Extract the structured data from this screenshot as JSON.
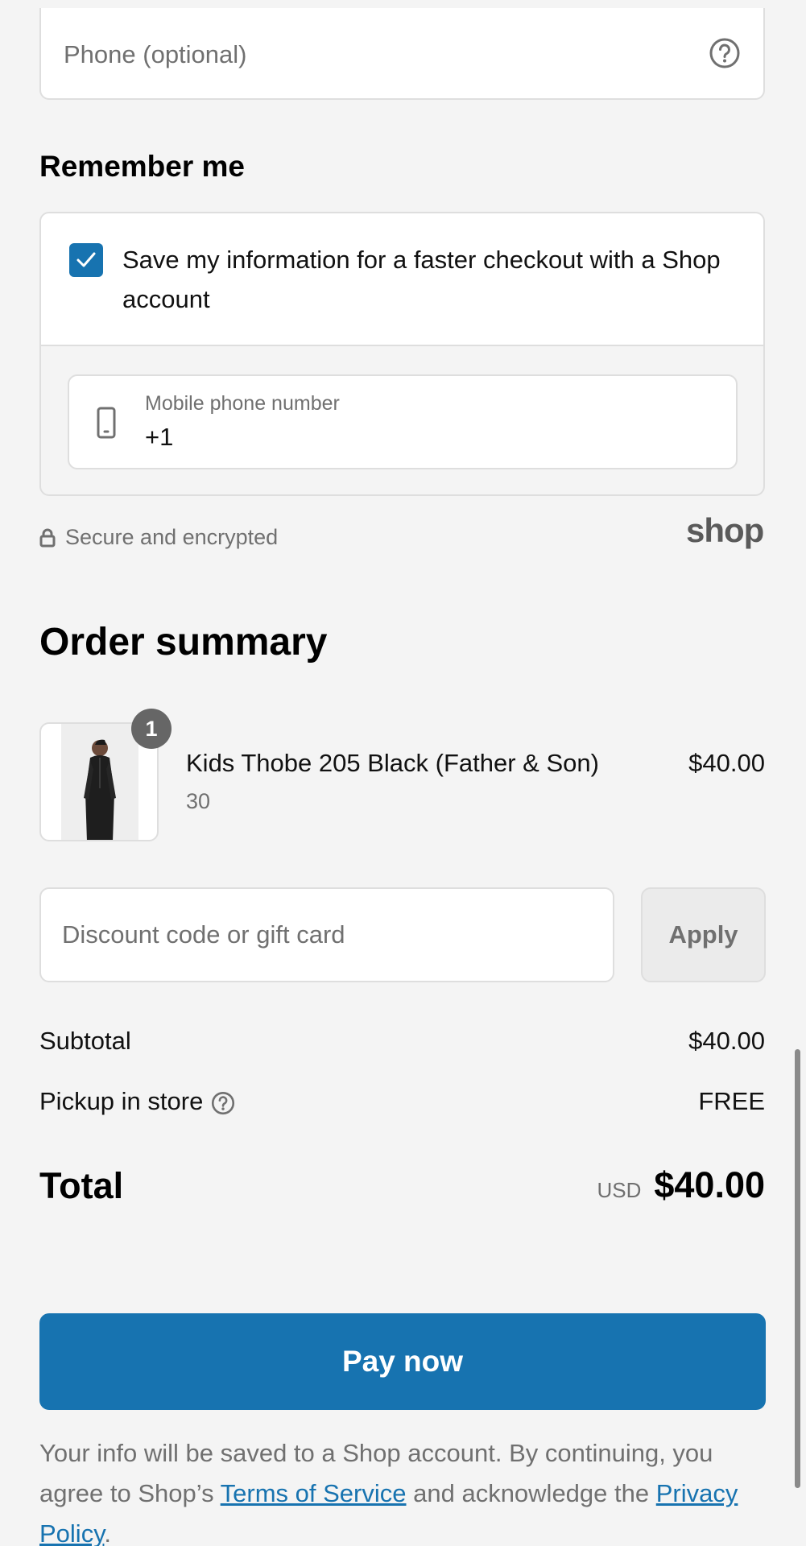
{
  "contact": {
    "phone_placeholder": "Phone (optional)"
  },
  "remember": {
    "title": "Remember me",
    "checkbox_checked": true,
    "checkbox_label": "Save my information for a faster checkout with a Shop account",
    "mobile_label": "Mobile phone number",
    "mobile_value": "+1",
    "secure_text": "Secure and encrypted",
    "shop_logo": "shop"
  },
  "order_summary": {
    "title": "Order summary",
    "items": [
      {
        "quantity": "1",
        "name": "Kids Thobe 205 Black (Father & Son)",
        "variant": "30",
        "price": "$40.00"
      }
    ],
    "discount_placeholder": "Discount code or gift card",
    "apply_label": "Apply",
    "subtotal_label": "Subtotal",
    "subtotal_value": "$40.00",
    "shipping_label": "Pickup in store",
    "shipping_value": "FREE",
    "total_label": "Total",
    "total_currency": "USD",
    "total_value": "$40.00"
  },
  "pay": {
    "label": "Pay now"
  },
  "legal": {
    "text_before": "Your info will be saved to a Shop account. By continuing, you agree to Shop’s ",
    "terms_link": "Terms of Service",
    "text_middle": " and acknowledge the ",
    "privacy_link": "Privacy Policy",
    "text_after": "."
  },
  "colors": {
    "accent": "#1773b0",
    "background": "#f4f4f4",
    "muted_text": "#707070"
  }
}
